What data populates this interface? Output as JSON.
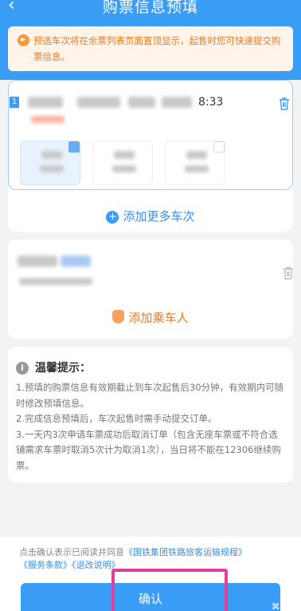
{
  "header": {
    "back_icon": "chevron-left-icon",
    "title": "购票信息预填"
  },
  "notice": {
    "icon": "megaphone-icon",
    "text": "预选车次将在余票列表页面置顶显示，起售时您可快速提交购票信息。"
  },
  "train_card": {
    "train_number_badge": "1",
    "time": "8:33",
    "delete_icon": "trash-icon",
    "add_more_label": "添加更多车次"
  },
  "passenger_card": {
    "delete_icon": "trash-icon",
    "add_passenger_label": "添加乘车人"
  },
  "tips": {
    "title": "温馨提示：",
    "items": [
      "1.预填的购票信息有效期截止到车次起售后30分钟，有效期内可随时修改预填信息。",
      "2.完成信息预填后，车次起售时需手动提交订单。",
      "3.一天内3次申请车票成功后取消订单（包含无座车票或不符合选铺需求车票时取消5次计为取消1次），当日将不能在12306继续购票。"
    ]
  },
  "agreement": {
    "prefix": "点击确认表示已阅读并同意",
    "link1": "《国铁集团铁路旅客运输规程》",
    "link2": "《服务条款》",
    "link3": "《退改说明》"
  },
  "confirm_button": {
    "label": "确认"
  },
  "colors": {
    "primary": "#3a9df5",
    "notice_text": "#f07a1a",
    "highlight": "#e0409a"
  }
}
